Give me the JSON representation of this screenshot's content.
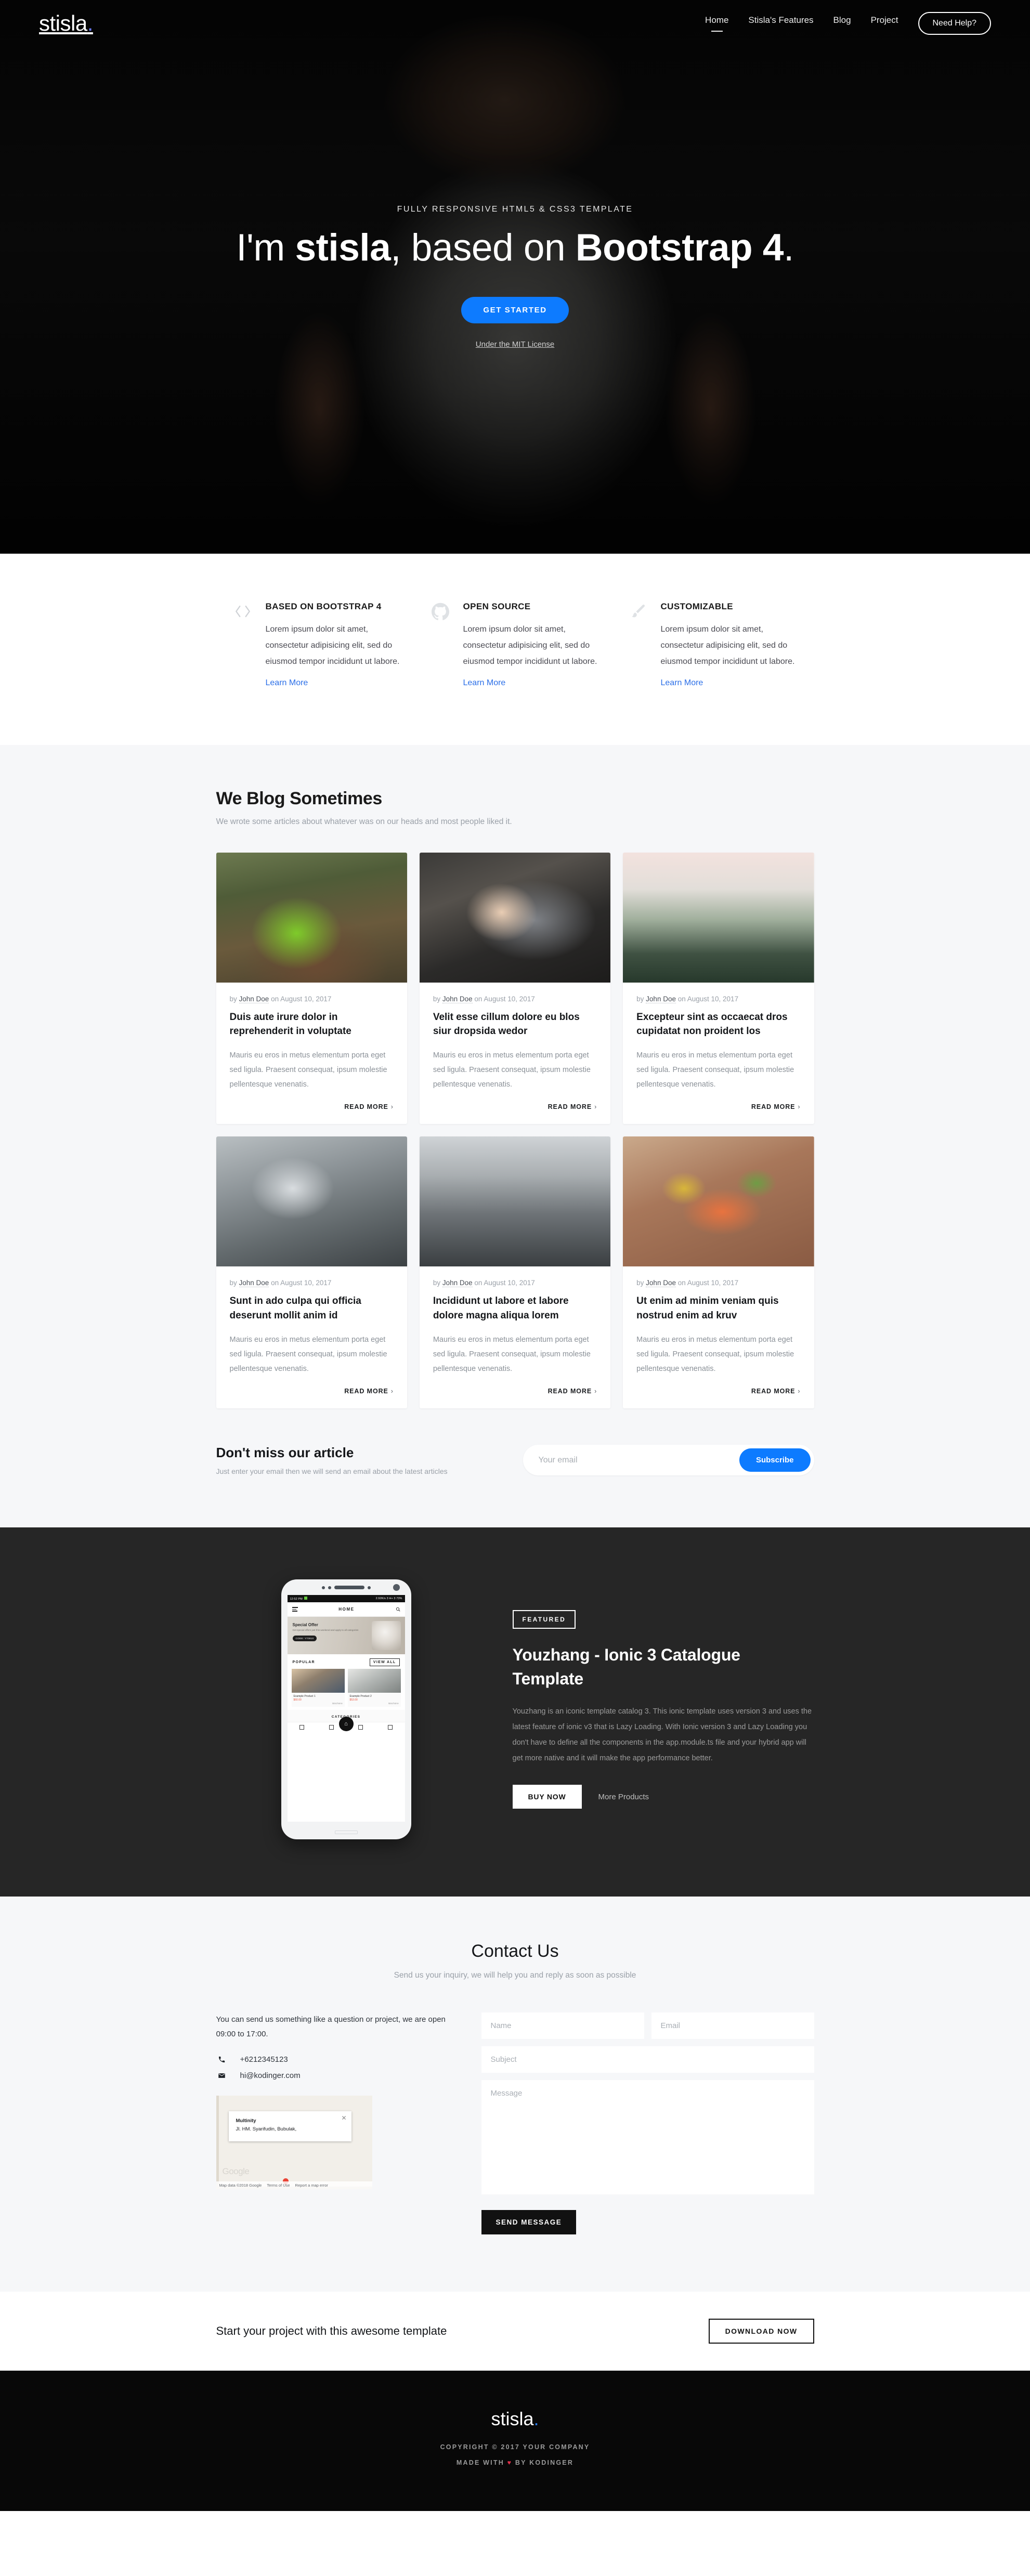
{
  "brand": {
    "name": "stisla",
    "dot": "."
  },
  "nav": {
    "links": [
      {
        "label": "Home",
        "active": true
      },
      {
        "label": "Stisla's Features",
        "active": false
      },
      {
        "label": "Blog",
        "active": false
      },
      {
        "label": "Project",
        "active": false
      }
    ],
    "button": "Need Help?"
  },
  "hero": {
    "eyebrow": "FULLY RESPONSIVE HTML5 & CSS3 TEMPLATE",
    "title_pre": "I'm ",
    "title_bold1": "stisla",
    "title_mid": ", based on ",
    "title_bold2": "Bootstrap 4",
    "title_end": ".",
    "cta": "GET STARTED",
    "sub_link": "Under the MIT License",
    "cta_color": "#0d7bff"
  },
  "features": [
    {
      "icon": "code-icon",
      "title": "BASED ON BOOTSTRAP 4",
      "text": "Lorem ipsum dolor sit amet, consectetur adipisicing elit, sed do eiusmod tempor incididunt ut labore.",
      "link": "Learn More"
    },
    {
      "icon": "github-icon",
      "title": "OPEN SOURCE",
      "text": "Lorem ipsum dolor sit amet, consectetur adipisicing elit, sed do eiusmod tempor incididunt ut labore.",
      "link": "Learn More"
    },
    {
      "icon": "paintbrush-icon",
      "title": "CUSTOMIZABLE",
      "text": "Lorem ipsum dolor sit amet, consectetur adipisicing elit, sed do eiusmod tempor incididunt ut labore.",
      "link": "Learn More"
    }
  ],
  "blog": {
    "title": "We Blog Sometimes",
    "subtitle": "We wrote some articles about whatever was on our heads and most people liked it.",
    "read_more": "READ MORE",
    "chevron": "›",
    "posts": [
      {
        "image": "mountain-bike-forest-trail",
        "meta_by": "by ",
        "author": "John Doe",
        "meta_on": " on August 10, 2017",
        "title": "Duis aute irure dolor in reprehenderit in voluptate",
        "excerpt": "Mauris eu eros in metus elementum porta eget sed ligula. Praesent consequat, ipsum molestie pellentesque venenatis."
      },
      {
        "image": "hands-typing-on-laptop",
        "meta_by": "by ",
        "author": "John Doe",
        "meta_on": " on August 10, 2017",
        "title": "Velit esse cillum dolore eu blos siur dropsida wedor",
        "excerpt": "Mauris eu eros in metus elementum porta eget sed ligula. Praesent consequat, ipsum molestie pellentesque venenatis."
      },
      {
        "image": "foggy-pine-forest",
        "meta_by": "by ",
        "author": "John Doe",
        "meta_on": " on August 10, 2017",
        "title": "Excepteur sint as occaecat dros cupidatat non proident los",
        "excerpt": "Mauris eu eros in metus elementum porta eget sed ligula. Praesent consequat, ipsum molestie pellentesque venenatis."
      },
      {
        "image": "skateboarder-street",
        "meta_by": "by ",
        "author": "John Doe",
        "meta_on": " on August 10, 2017",
        "title": "Sunt in ado culpa qui officia deserunt mollit anim id",
        "excerpt": "Mauris eu eros in metus elementum porta eget sed ligula. Praesent consequat, ipsum molestie pellentesque venenatis."
      },
      {
        "image": "bare-trees-winter",
        "meta_by": "by ",
        "author": "John Doe",
        "meta_on": " on August 10, 2017",
        "title": "Incididunt ut labore et labore dolore magna aliqua lorem",
        "excerpt": "Mauris eu eros in metus elementum porta eget sed ligula. Praesent consequat, ipsum molestie pellentesque venenatis."
      },
      {
        "image": "grilled-salmon-plate",
        "meta_by": "by ",
        "author": "John Doe",
        "meta_on": " on August 10, 2017",
        "title": "Ut enim ad minim veniam quis nostrud enim ad kruv",
        "excerpt": "Mauris eu eros in metus elementum porta eget sed ligula. Praesent consequat, ipsum molestie pellentesque venenatis."
      }
    ]
  },
  "subscribe": {
    "title": "Don't miss our article",
    "subtitle": "Just enter your email then we will send an email about the latest articles",
    "placeholder": "Your email",
    "value": "",
    "button": "Subscribe",
    "button_color": "#0d7bff"
  },
  "product": {
    "badge": "FEATURED",
    "title": "Youzhang - Ionic 3 Catalogue Template",
    "description": "Youzhang is an iconic template catalog 3. This ionic template uses version 3 and uses the latest feature of ionic v3 that is Lazy Loading. With Ionic version 3 and Lazy Loading you don't have to define all the components in the app.module.ts file and your hybrid app will get more native and it will make the app performance better.",
    "buy_button": "BUY NOW",
    "more_link": "More Products",
    "phone": {
      "status_time": "12:52 PM",
      "status_right": "2.92K/s  3 H+  3  73%",
      "nav_title": "HOME",
      "offer_title": "Special Offer",
      "offer_text": "Get special offers just this weekend and apply to all categories",
      "offer_code": "CODE: Y70810",
      "popular": "POPULAR",
      "view_all": "VIEW ALL",
      "categories": "CATEGORIES",
      "products": [
        {
          "name": "Example Product 1",
          "price": "$60.00",
          "brand": "Brand Name"
        },
        {
          "name": "Example Product 2",
          "price": "$53.00",
          "brand": "Brand Name"
        }
      ]
    }
  },
  "contact": {
    "title": "Contact Us",
    "subtitle": "Send us your inquiry, we will help you and reply as soon as possible",
    "intro": "You can send us something like a question or project, we are open 09:00 to 17:00.",
    "phone": "+6212345123",
    "email": "hi@kodinger.com",
    "map": {
      "place": "Multinity",
      "address": "Jl. HM. Syarifudin, Bubulak,",
      "close": "✕",
      "watermark": "Google",
      "attribution": "Map data ©2018 Google",
      "terms": "Terms of Use",
      "report": "Report a map error"
    },
    "form": {
      "name_placeholder": "Name",
      "email_placeholder": "Email",
      "subject_placeholder": "Subject",
      "message_placeholder": "Message",
      "name_value": "",
      "email_value": "",
      "subject_value": "",
      "message_value": "",
      "submit": "SEND MESSAGE"
    }
  },
  "cta": {
    "text": "Start your project with this awesome template",
    "button": "DOWNLOAD NOW"
  },
  "footer": {
    "brand": "stisla",
    "dot": ".",
    "copyright": "COPYRIGHT © 2017 YOUR COMPANY",
    "made_pre": "MADE WITH ",
    "heart": "♥",
    "made_post": " BY KODINGER"
  }
}
